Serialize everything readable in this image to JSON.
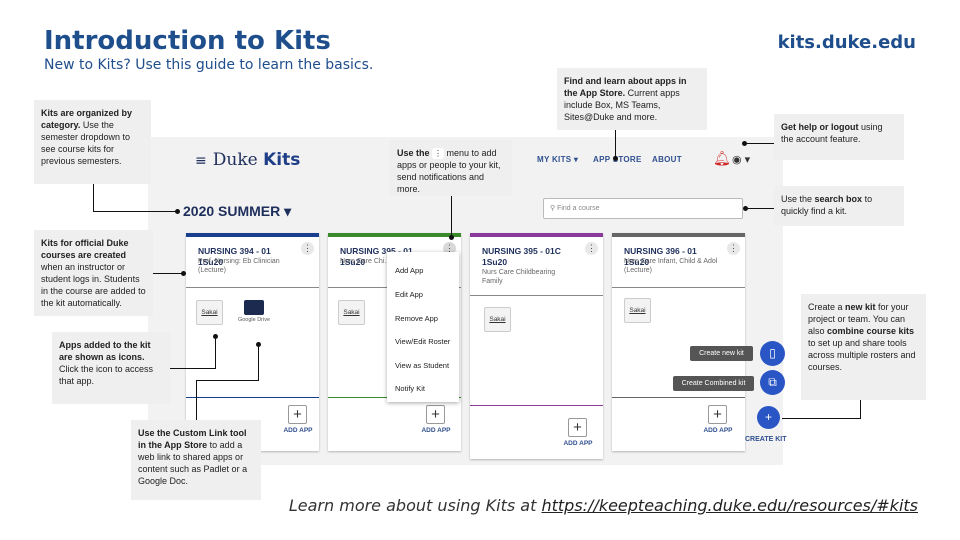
{
  "header": {
    "title": "Introduction to Kits",
    "subtitle": "New to Kits? Use this guide to learn the basics.",
    "site": "kits.duke.edu"
  },
  "app": {
    "logo_word": "Duke",
    "logo_kits": "Kits",
    "nav": [
      "MY KITS ▾",
      "APP STORE",
      "ABOUT"
    ],
    "semester": "2020 SUMMER ▾",
    "search_placeholder": "Find a course",
    "add_app_label": "ADD APP",
    "create_kit_label": "CREATE KIT",
    "create_new_kit": "Create new kit",
    "create_combined_kit": "Create Combined kit"
  },
  "cards": [
    {
      "title": "NURSING 394 - 01 1Su20",
      "sub": "Prof. Nursing: Eb Clinician (Lecture)",
      "color": "#1a3f8f",
      "apps": [
        "Sakai",
        "Google Drive"
      ]
    },
    {
      "title": "NURSING 395 - 01 1Su20",
      "sub": "Nurs Care Chi… Family (Lectu…",
      "color": "#3a8a2c",
      "apps": [
        "Sakai"
      ]
    },
    {
      "title": "NURSING 395 - 01C 1Su20",
      "sub": "Nurs Care Childbearing Family",
      "color": "#8a3a9a",
      "apps": [
        "Sakai"
      ]
    },
    {
      "title": "NURSING 396 - 01 1Su20",
      "sub": "Nurs Care Infant, Child & Adol (Lecture)",
      "color": "#666666",
      "apps": [
        "Sakai"
      ]
    }
  ],
  "dropdown": [
    "Add App",
    "Edit App",
    "Remove App",
    "View/Edit Roster",
    "View as Student",
    "Notify Kit"
  ],
  "callouts": {
    "category_bold": "Kits are organized by category.",
    "category_rest": " Use the semester dropdown to see course kits for previous semesters.",
    "appstore_bold": "Find and learn about apps in the App Store.",
    "appstore_rest": " Current apps include Box, MS Teams, Sites@Duke and more.",
    "menu_a": "Use the ",
    "menu_b": " menu to add apps or people to your kit, send notifications and more.",
    "help_bold": "Get help or logout",
    "help_rest": " using the account feature.",
    "search_a": "Use the ",
    "search_bold": "search box",
    "search_rest": " to quickly find a kit.",
    "official_bold": "Kits for official Duke courses are created",
    "official_rest": " when an instructor or student logs in. Students in the course are added to the kit automatically.",
    "icons_bold": "Apps added to the kit are shown as icons.",
    "icons_rest": " Click the icon to access that app.",
    "custom_bold": "Use the Custom Link tool in the App Store",
    "custom_rest": " to add a web link to shared apps or content such as Padlet or a Google Doc.",
    "create_a": "Create a ",
    "create_bold": "new kit",
    "create_b": " for your project or team. You can also ",
    "create_bold2": "combine course kits",
    "create_c": " to set up and share tools across multiple rosters and courses."
  },
  "footer": {
    "text": "Learn more about using Kits at ",
    "link": "https://keepteaching.duke.edu/resources/#kits"
  }
}
